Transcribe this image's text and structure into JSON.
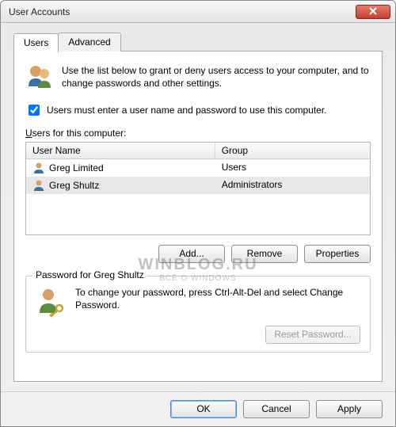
{
  "window": {
    "title": "User Accounts"
  },
  "tabs": {
    "users": "Users",
    "advanced": "Advanced"
  },
  "intro": "Use the list below to grant or deny users access to your computer, and to change passwords and other settings.",
  "checkbox": {
    "label": "Users must enter a user name and password to use this computer.",
    "checked": true
  },
  "list": {
    "label_prefix": "U",
    "label_rest": "sers for this computer:",
    "header": {
      "name": "User Name",
      "group": "Group"
    },
    "rows": [
      {
        "name": "Greg Limited",
        "group": "Users",
        "selected": false
      },
      {
        "name": "Greg Shultz",
        "group": "Administrators",
        "selected": true
      }
    ]
  },
  "buttons": {
    "add": "Add...",
    "remove": "Remove",
    "properties": "Properties",
    "reset_password": "Reset Password...",
    "ok": "OK",
    "cancel": "Cancel",
    "apply": "Apply"
  },
  "passwordbox": {
    "title": "Password for Greg Shultz",
    "text": "To change your password, press Ctrl-Alt-Del and select Change Password."
  },
  "watermark": {
    "line1": "WINBLOG.RU",
    "line2": "ВСЁ О WINDOWS"
  }
}
